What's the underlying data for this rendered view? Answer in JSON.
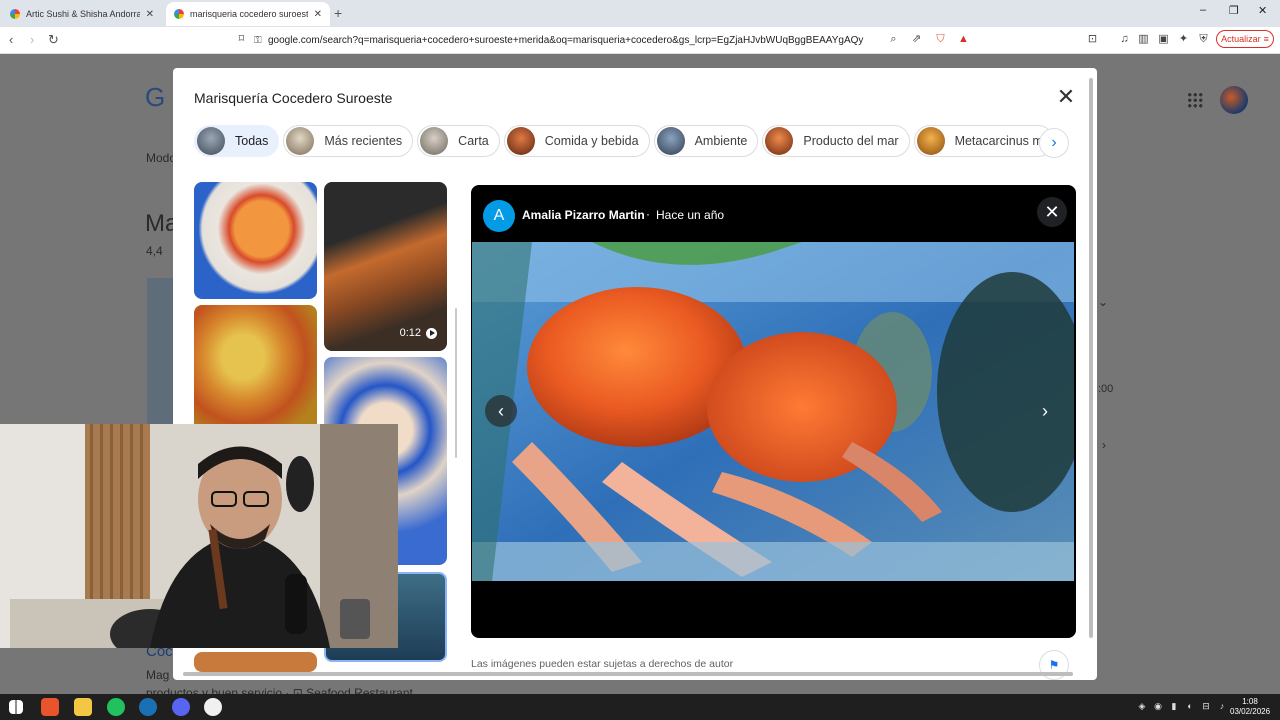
{
  "browser": {
    "tabs": [
      {
        "title": "Artic Sushi & Shisha Andorra Reseña"
      },
      {
        "title": "marisqueria cocedero suroeste m"
      }
    ],
    "new_tab": "+",
    "url": "google.com/search?q=marisqueria+cocedero+suroeste+merida&oq=marisqueria+cocedero&gs_lcrp=EgZjaHJvbWUqBggBEAAYgAQyBggAEE...",
    "update_button": "Actualizar",
    "window_controls": {
      "minimize": "–",
      "maximize": "❐",
      "close": "✕"
    }
  },
  "background_page": {
    "logo_letter": "G",
    "nav_fragment": "Modo",
    "title_fragment": "Ma",
    "rating_fragment": "4,4",
    "link_fragment": "Coc",
    "snippet_line1": "Mag",
    "snippet_line2": "productos y buen servicio · ⊡ Seafood Restaurant",
    "side_time": ":00"
  },
  "modal": {
    "title": "Marisquería Cocedero Suroeste",
    "chips": [
      {
        "label": "Todas",
        "active": true,
        "color": "#6b7a8a"
      },
      {
        "label": "Más recientes",
        "active": false,
        "color": "#c7b9a0"
      },
      {
        "label": "Carta",
        "active": false,
        "color": "#b0a898"
      },
      {
        "label": "Comida y bebida",
        "active": false,
        "color": "#b5562e"
      },
      {
        "label": "Ambiente",
        "active": false,
        "color": "#5c6f86"
      },
      {
        "label": "Producto del mar",
        "active": false,
        "color": "#c55a2a"
      },
      {
        "label": "Metacarcinus m",
        "active": false,
        "color": "#d98a2b"
      }
    ],
    "gallery": [
      {
        "name": "food-photo"
      },
      {
        "name": "crab-video",
        "duration": "0:12"
      },
      {
        "name": "paella-photo"
      },
      {
        "name": "scallops-photo"
      },
      {
        "name": "restaurant-photo"
      },
      {
        "name": "dish-photo"
      }
    ],
    "viewer": {
      "author_initial": "A",
      "author": "Amalia Pizarro Martin",
      "separator": "·",
      "time": "Hace un año"
    },
    "copyright": "Las imágenes pueden estar sujetas a derechos de autor"
  },
  "taskbar": {
    "time": "1:08",
    "date": "03/02/2026"
  }
}
